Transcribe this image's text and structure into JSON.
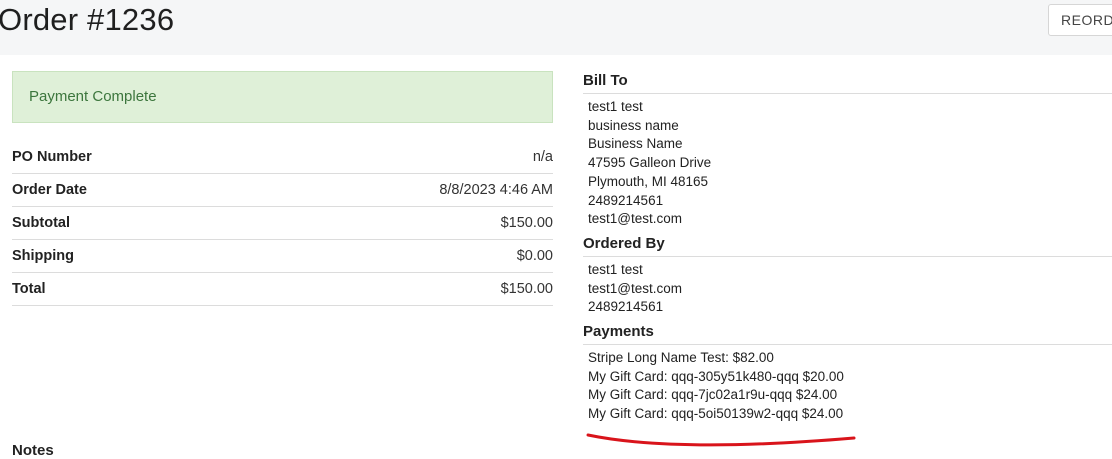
{
  "header": {
    "title": "Order #1236",
    "reorder_label": "REORDER"
  },
  "status": {
    "message": "Payment Complete"
  },
  "summary": {
    "rows": [
      {
        "label": "PO Number",
        "value": "n/a"
      },
      {
        "label": "Order Date",
        "value": "8/8/2023 4:46 AM"
      },
      {
        "label": "Subtotal",
        "value": "$150.00"
      },
      {
        "label": "Shipping",
        "value": "$0.00"
      },
      {
        "label": "Total",
        "value": "$150.00"
      }
    ]
  },
  "notes": {
    "heading": "Notes"
  },
  "bill_to": {
    "heading": "Bill To",
    "lines": [
      "test1 test",
      "business name",
      "Business Name",
      "47595 Galleon Drive",
      "Plymouth, MI 48165",
      "2489214561",
      "test1@test.com"
    ]
  },
  "ordered_by": {
    "heading": "Ordered By",
    "lines": [
      "test1 test",
      "test1@test.com",
      "2489214561"
    ]
  },
  "payments": {
    "heading": "Payments",
    "lines": [
      "Stripe Long Name Test: $82.00",
      "My Gift Card: qqq-305y51k480-qqq $20.00",
      "My Gift Card: qqq-7jc02a1r9u-qqq $24.00",
      "My Gift Card: qqq-5oi50139w2-qqq $24.00"
    ]
  },
  "colors": {
    "header_bg": "#f5f6f7",
    "success_bg": "#dff0d8",
    "success_text": "#3c763d",
    "annotation_red": "#d9141b"
  }
}
